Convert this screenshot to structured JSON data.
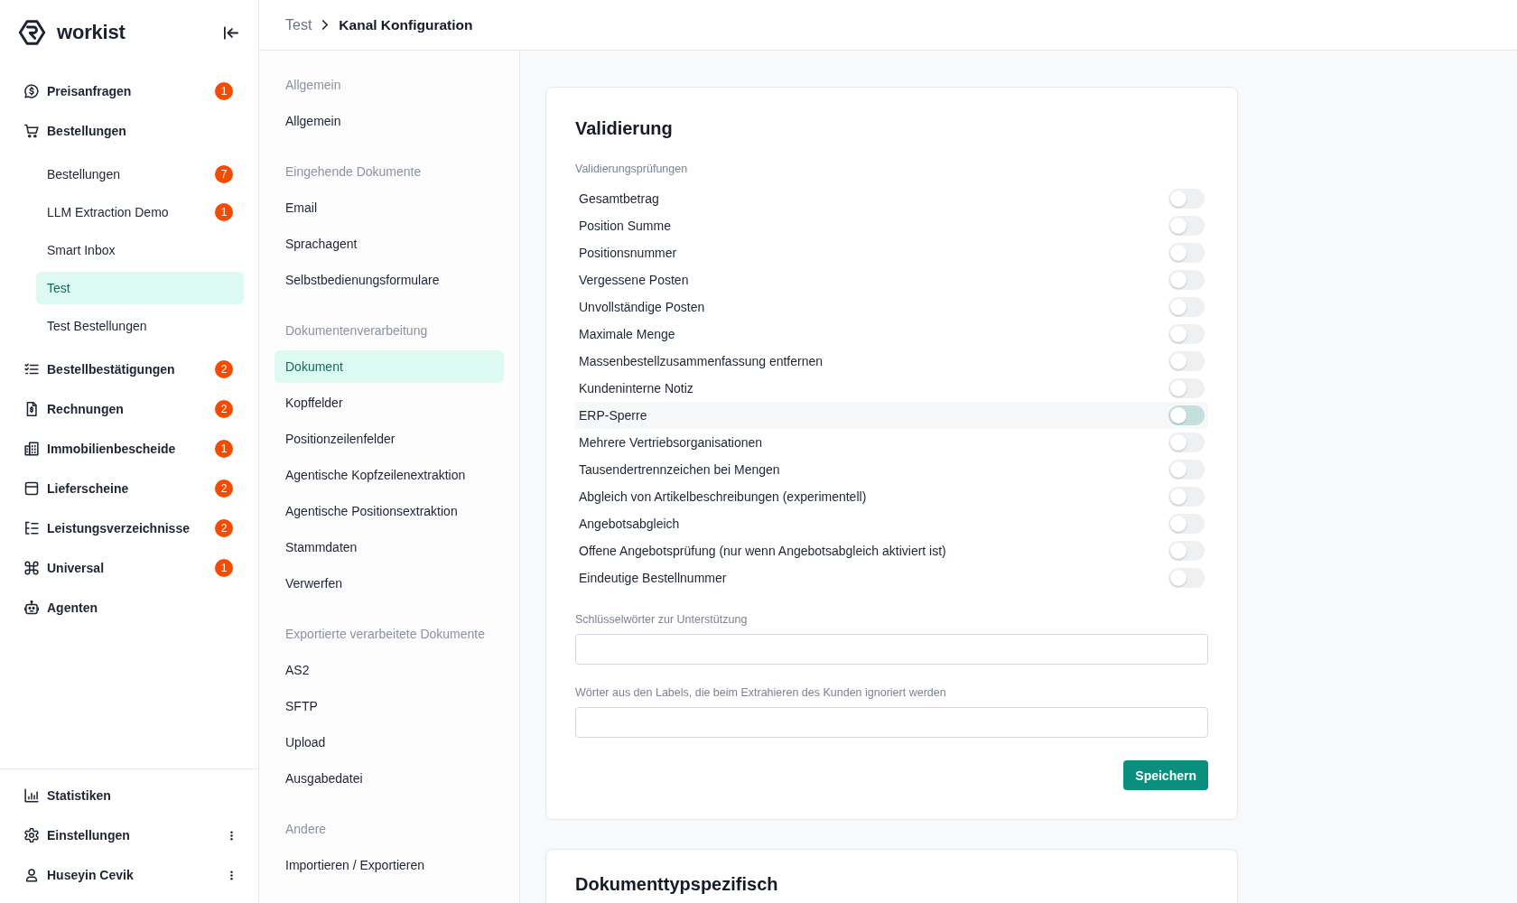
{
  "sidebar": {
    "logo": "workist",
    "nav": [
      {
        "label": "Preisanfragen",
        "badge": "1",
        "selected": false
      },
      {
        "label": "Bestellungen",
        "selected": false,
        "children": [
          {
            "label": "Bestellungen",
            "badge": "7",
            "selected": false
          },
          {
            "label": "LLM Extraction Demo",
            "badge": "1",
            "selected": false
          },
          {
            "label": "Smart Inbox",
            "selected": false
          },
          {
            "label": "Test",
            "selected": true
          },
          {
            "label": "Test Bestellungen",
            "selected": false
          }
        ]
      },
      {
        "label": "Bestellbestätigungen",
        "badge": "2",
        "selected": false
      },
      {
        "label": "Rechnungen",
        "badge": "2",
        "selected": false
      },
      {
        "label": "Immobilienbescheide",
        "badge": "1",
        "selected": false
      },
      {
        "label": "Lieferscheine",
        "badge": "2",
        "selected": false
      },
      {
        "label": "Leistungsverzeichnisse",
        "badge": "2",
        "selected": false
      },
      {
        "label": "Universal",
        "badge": "1",
        "selected": false
      },
      {
        "label": "Agenten",
        "selected": false
      }
    ],
    "footer": [
      {
        "label": "Statistiken",
        "menu": false,
        "selected": false
      },
      {
        "label": "Einstellungen",
        "menu": true,
        "selected": false
      },
      {
        "label": "Huseyin Cevik",
        "menu": true,
        "selected": false
      }
    ]
  },
  "breadcrumb": [
    {
      "label": "Test",
      "current": false
    },
    {
      "label": "Kanal Konfiguration",
      "current": true
    }
  ],
  "settings_nav": {
    "sections": [
      {
        "heading": "Allgemein",
        "items": [
          {
            "label": "Allgemein",
            "selected": false
          }
        ]
      },
      {
        "heading": "Eingehende Dokumente",
        "items": [
          {
            "label": "Email",
            "selected": false
          },
          {
            "label": "Sprachagent",
            "selected": false
          },
          {
            "label": "Selbstbedienungsformulare",
            "selected": false
          }
        ]
      },
      {
        "heading": "Dokumentenverarbeitung",
        "items": [
          {
            "label": "Dokument",
            "selected": true
          },
          {
            "label": "Kopffelder",
            "selected": false
          },
          {
            "label": "Positionzeilenfelder",
            "selected": false
          },
          {
            "label": "Agentische Kopfzeilenextraktion",
            "selected": false
          },
          {
            "label": "Agentische Positionsextraktion",
            "selected": false
          },
          {
            "label": "Stammdaten",
            "selected": false
          },
          {
            "label": "Verwerfen",
            "selected": false
          }
        ]
      },
      {
        "heading": "Exportierte verarbeitete Dokumente",
        "items": [
          {
            "label": "AS2",
            "selected": false
          },
          {
            "label": "SFTP",
            "selected": false
          },
          {
            "label": "Upload",
            "selected": false
          },
          {
            "label": "Ausgabedatei",
            "selected": false
          }
        ]
      },
      {
        "heading": "Andere",
        "items": [
          {
            "label": "Importieren / Exportieren",
            "selected": false
          }
        ]
      }
    ]
  },
  "cards": [
    {
      "title": "Validierung",
      "group_label": "Validierungsprüfungen",
      "checks": [
        {
          "label": "Gesamtbetrag",
          "on": false,
          "highlighted": false
        },
        {
          "label": "Position Summe",
          "on": false,
          "highlighted": false
        },
        {
          "label": "Positionsnummer",
          "on": false,
          "highlighted": false
        },
        {
          "label": "Vergessene Posten",
          "on": false,
          "highlighted": false
        },
        {
          "label": "Unvollständige Posten",
          "on": false,
          "highlighted": false
        },
        {
          "label": "Maximale Menge",
          "on": false,
          "highlighted": false
        },
        {
          "label": "Massenbestellzusammenfassung entfernen",
          "on": false,
          "highlighted": false
        },
        {
          "label": "Kundeninterne Notiz",
          "on": false,
          "highlighted": false
        },
        {
          "label": "ERP-Sperre",
          "on": false,
          "highlighted": true
        },
        {
          "label": "Mehrere Vertriebsorganisationen",
          "on": false,
          "highlighted": false
        },
        {
          "label": "Tausendertrennzeichen bei Mengen",
          "on": false,
          "highlighted": false
        },
        {
          "label": "Abgleich von Artikelbeschreibungen (experimentell)",
          "on": false,
          "highlighted": false
        },
        {
          "label": "Angebotsabgleich",
          "on": false,
          "highlighted": false
        },
        {
          "label": "Offene Angebotsprüfung (nur wenn Angebotsabgleich aktiviert ist)",
          "on": false,
          "highlighted": false
        },
        {
          "label": "Eindeutige Bestellnummer",
          "on": false,
          "highlighted": false
        }
      ],
      "fields": [
        {
          "label": "Schlüsselwörter zur Unterstützung"
        },
        {
          "label": "Wörter aus den Labels, die beim Extrahieren des Kunden ignoriert werden"
        }
      ],
      "button": "Speichern"
    },
    {
      "title": "Dokumenttypspezifisch"
    }
  ]
}
